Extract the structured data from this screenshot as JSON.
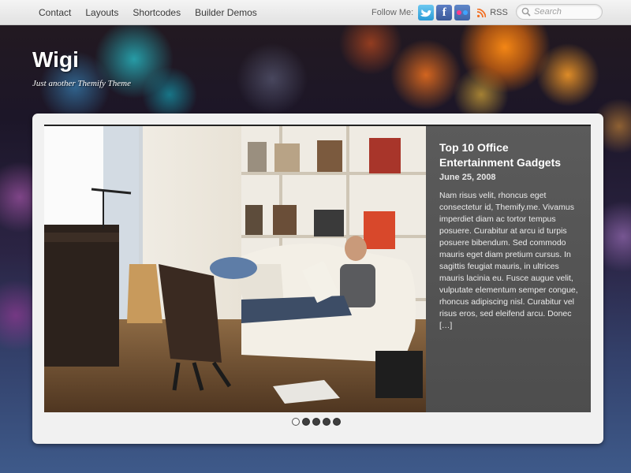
{
  "nav": {
    "items": [
      "Contact",
      "Layouts",
      "Shortcodes",
      "Builder Demos"
    ]
  },
  "social": {
    "label": "Follow Me:",
    "icons": [
      "twitter-icon",
      "facebook-icon",
      "flickr-icon"
    ],
    "rss_label": "RSS"
  },
  "search": {
    "placeholder": "Search"
  },
  "header": {
    "site_title": "Wigi",
    "tagline": "Just another Themify Theme"
  },
  "slider": {
    "title": "Top 10 Office Entertainment Gadgets",
    "date": "June 25, 2008",
    "excerpt": "Nam risus velit, rhoncus eget consectetur id, Themify.me. Vivamus imperdiet diam ac tortor tempus posuere. Curabitur at arcu id turpis posuere bibendum. Sed commodo mauris eget diam pretium cursus. In sagittis feugiat mauris, in ultrices mauris lacinia eu. Fusce augue velit, vulputate elementum semper congue, rhoncus adipiscing nisl. Curabitur vel risus eros, sed eleifend arcu. Donec […]",
    "active_slide": 1,
    "slide_count": 5
  },
  "colors": {
    "topbar": "#e6e6e6",
    "panel": "#f1f1f1",
    "caption_bg": "#555555"
  }
}
